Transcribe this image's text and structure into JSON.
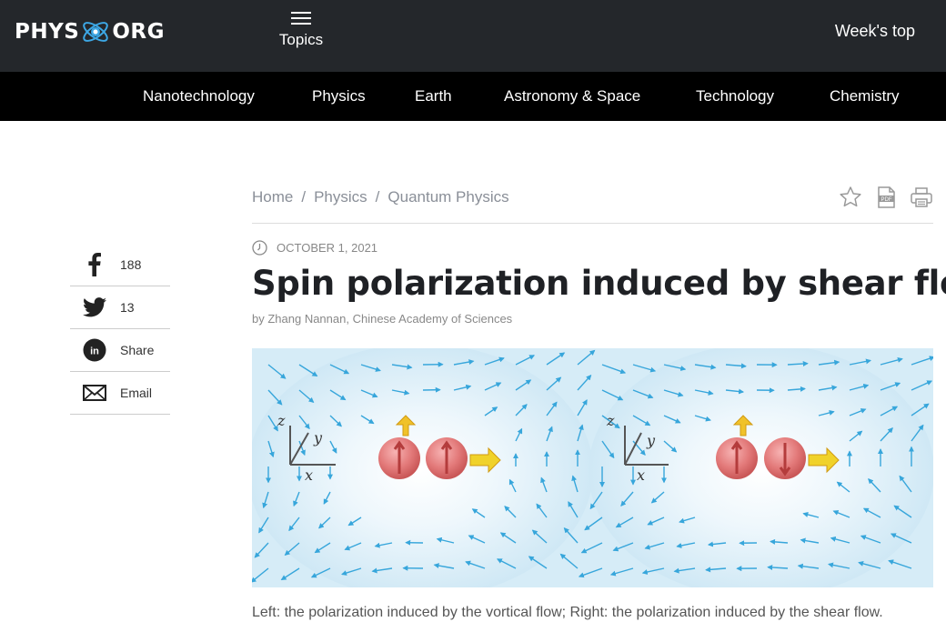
{
  "header": {
    "logo_left": "PHYS",
    "logo_right": "ORG",
    "menu_label": "Topics",
    "weeks_top": "Week's top"
  },
  "categories": [
    "Nanotechnology",
    "Physics",
    "Earth",
    "Astronomy & Space",
    "Technology",
    "Chemistry"
  ],
  "share": [
    {
      "icon": "facebook-icon",
      "label": "188"
    },
    {
      "icon": "twitter-icon",
      "label": "13"
    },
    {
      "icon": "linkedin-icon",
      "label": "Share"
    },
    {
      "icon": "email-icon",
      "label": "Email"
    }
  ],
  "breadcrumb": [
    "Home",
    "Physics",
    "Quantum Physics"
  ],
  "tools": [
    "star-icon",
    "pdf-icon",
    "print-icon"
  ],
  "article": {
    "date": "OCTOBER 1, 2021",
    "title": "Spin polarization induced by shear flow",
    "byline": "by Zhang Nannan, Chinese Academy of Sciences",
    "caption": "Left: the polarization induced by the vortical flow; Right: the polarization induced by the shear flow."
  },
  "figure": {
    "axis_labels": [
      "z",
      "y",
      "x"
    ],
    "colors": {
      "background": "#dbeef8",
      "arrow": "#37a6db",
      "sphere": "#e06a6a",
      "motion_arrow": "#f0d22a"
    }
  }
}
